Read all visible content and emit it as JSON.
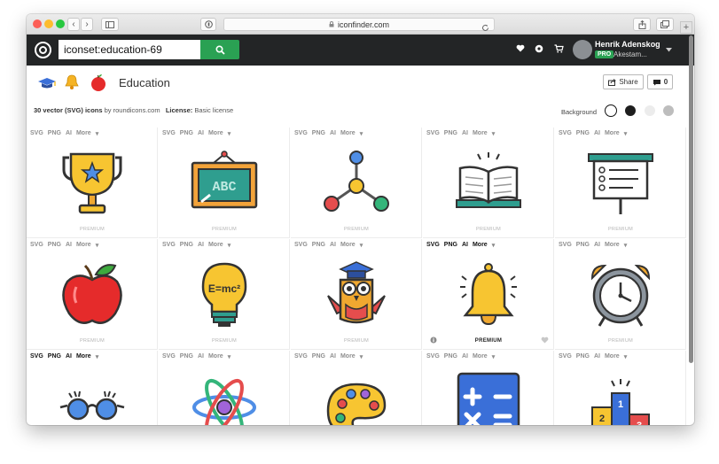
{
  "browser": {
    "url": "iconfinder.com",
    "nav_back": "‹",
    "nav_forward": "›"
  },
  "topbar": {
    "search_value": "iconset:education-69",
    "user_name": "Henrik Adenskog",
    "user_badge": "PRO",
    "user_sub": "Akestam..."
  },
  "header": {
    "title": "Education",
    "share_label": "Share",
    "comments_count": "0",
    "meta_count": "30 vector (SVG) icons",
    "meta_by": "by roundicons.com",
    "license_label": "License:",
    "license_value": "Basic license",
    "background_label": "Background"
  },
  "colors": {
    "topbar": "#232526",
    "search_button": "#2aa153",
    "pro_badge": "#2aa153"
  },
  "formats": [
    "SVG",
    "PNG",
    "AI",
    "More"
  ],
  "premium_label": "PREMIUM",
  "icons": [
    {
      "name": "trophy-icon"
    },
    {
      "name": "abc-chalkboard-icon"
    },
    {
      "name": "molecule-icon"
    },
    {
      "name": "open-book-icon"
    },
    {
      "name": "presentation-board-icon"
    },
    {
      "name": "apple-icon"
    },
    {
      "name": "lightbulb-emc2-icon"
    },
    {
      "name": "owl-graduate-icon"
    },
    {
      "name": "bell-icon"
    },
    {
      "name": "alarm-clock-icon"
    },
    {
      "name": "glasses-icon"
    },
    {
      "name": "atom-icon"
    },
    {
      "name": "paint-palette-icon"
    },
    {
      "name": "calculator-icon"
    },
    {
      "name": "podium-icon"
    }
  ]
}
